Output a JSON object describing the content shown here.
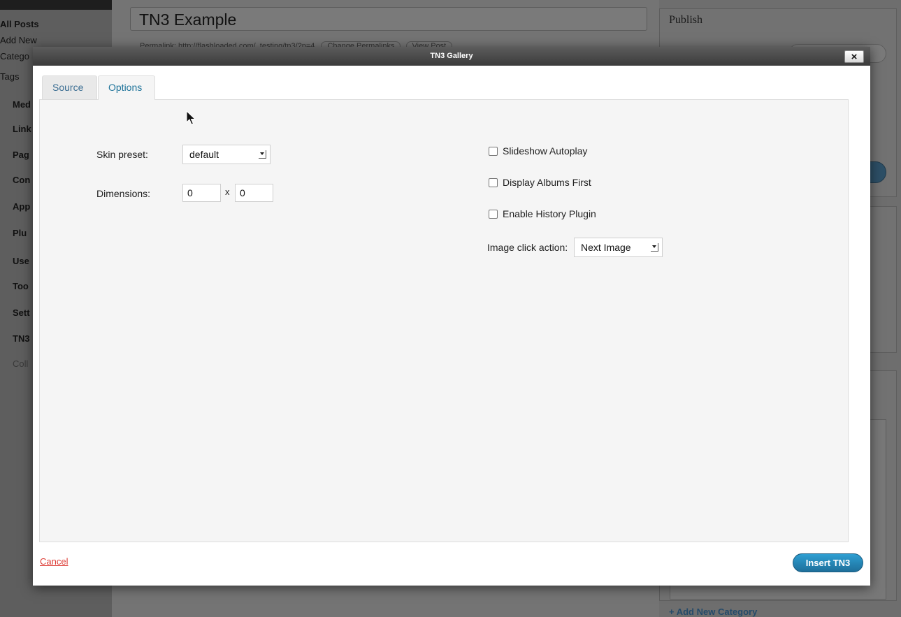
{
  "background": {
    "sidebar_items": [
      {
        "label": "All Posts",
        "style": "bold"
      },
      {
        "label": "Add New",
        "style": "normal"
      },
      {
        "label": "Catego",
        "style": "normal"
      },
      {
        "label": "Tags",
        "style": "normal"
      },
      {
        "label": "Med",
        "style": "bold"
      },
      {
        "label": "Link",
        "style": "bold"
      },
      {
        "label": "Pag",
        "style": "bold"
      },
      {
        "label": "Con",
        "style": "bold"
      },
      {
        "label": "App",
        "style": "bold"
      },
      {
        "label": "Plu",
        "style": "bold"
      },
      {
        "label": "Use",
        "style": "bold"
      },
      {
        "label": "Too",
        "style": "bold"
      },
      {
        "label": "Sett",
        "style": "bold"
      },
      {
        "label": "TN3",
        "style": "bold"
      },
      {
        "label": "Coll",
        "style": "dim"
      }
    ],
    "post_title": "TN3 Example",
    "permalink_text": "Permalink: http://flashloaded.com/_testing/tn3/?p=4",
    "change_permalinks_label": "Change Permalinks",
    "view_post_label": "View Post",
    "publish_title": "Publish",
    "add_new_category": "+ Add New Category"
  },
  "modal": {
    "title": "TN3 Gallery",
    "close_label": "×",
    "tabs": [
      {
        "label": "Source",
        "active": false
      },
      {
        "label": "Options",
        "active": true
      }
    ],
    "options": {
      "skin_preset_label": "Skin preset:",
      "skin_preset_value": "default",
      "dimensions_label": "Dimensions:",
      "width_value": "0",
      "height_value": "0",
      "dimension_separator": "x",
      "slideshow_autoplay_label": "Slideshow Autoplay",
      "display_albums_first_label": "Display Albums First",
      "enable_history_plugin_label": "Enable History Plugin",
      "image_click_action_label": "Image click action:",
      "image_click_action_value": "Next Image"
    },
    "cancel_label": "Cancel",
    "insert_label": "Insert TN3"
  },
  "colors": {
    "accent": "#21759b",
    "cancel": "#dd3d36",
    "insert_button": "#2683b5"
  }
}
